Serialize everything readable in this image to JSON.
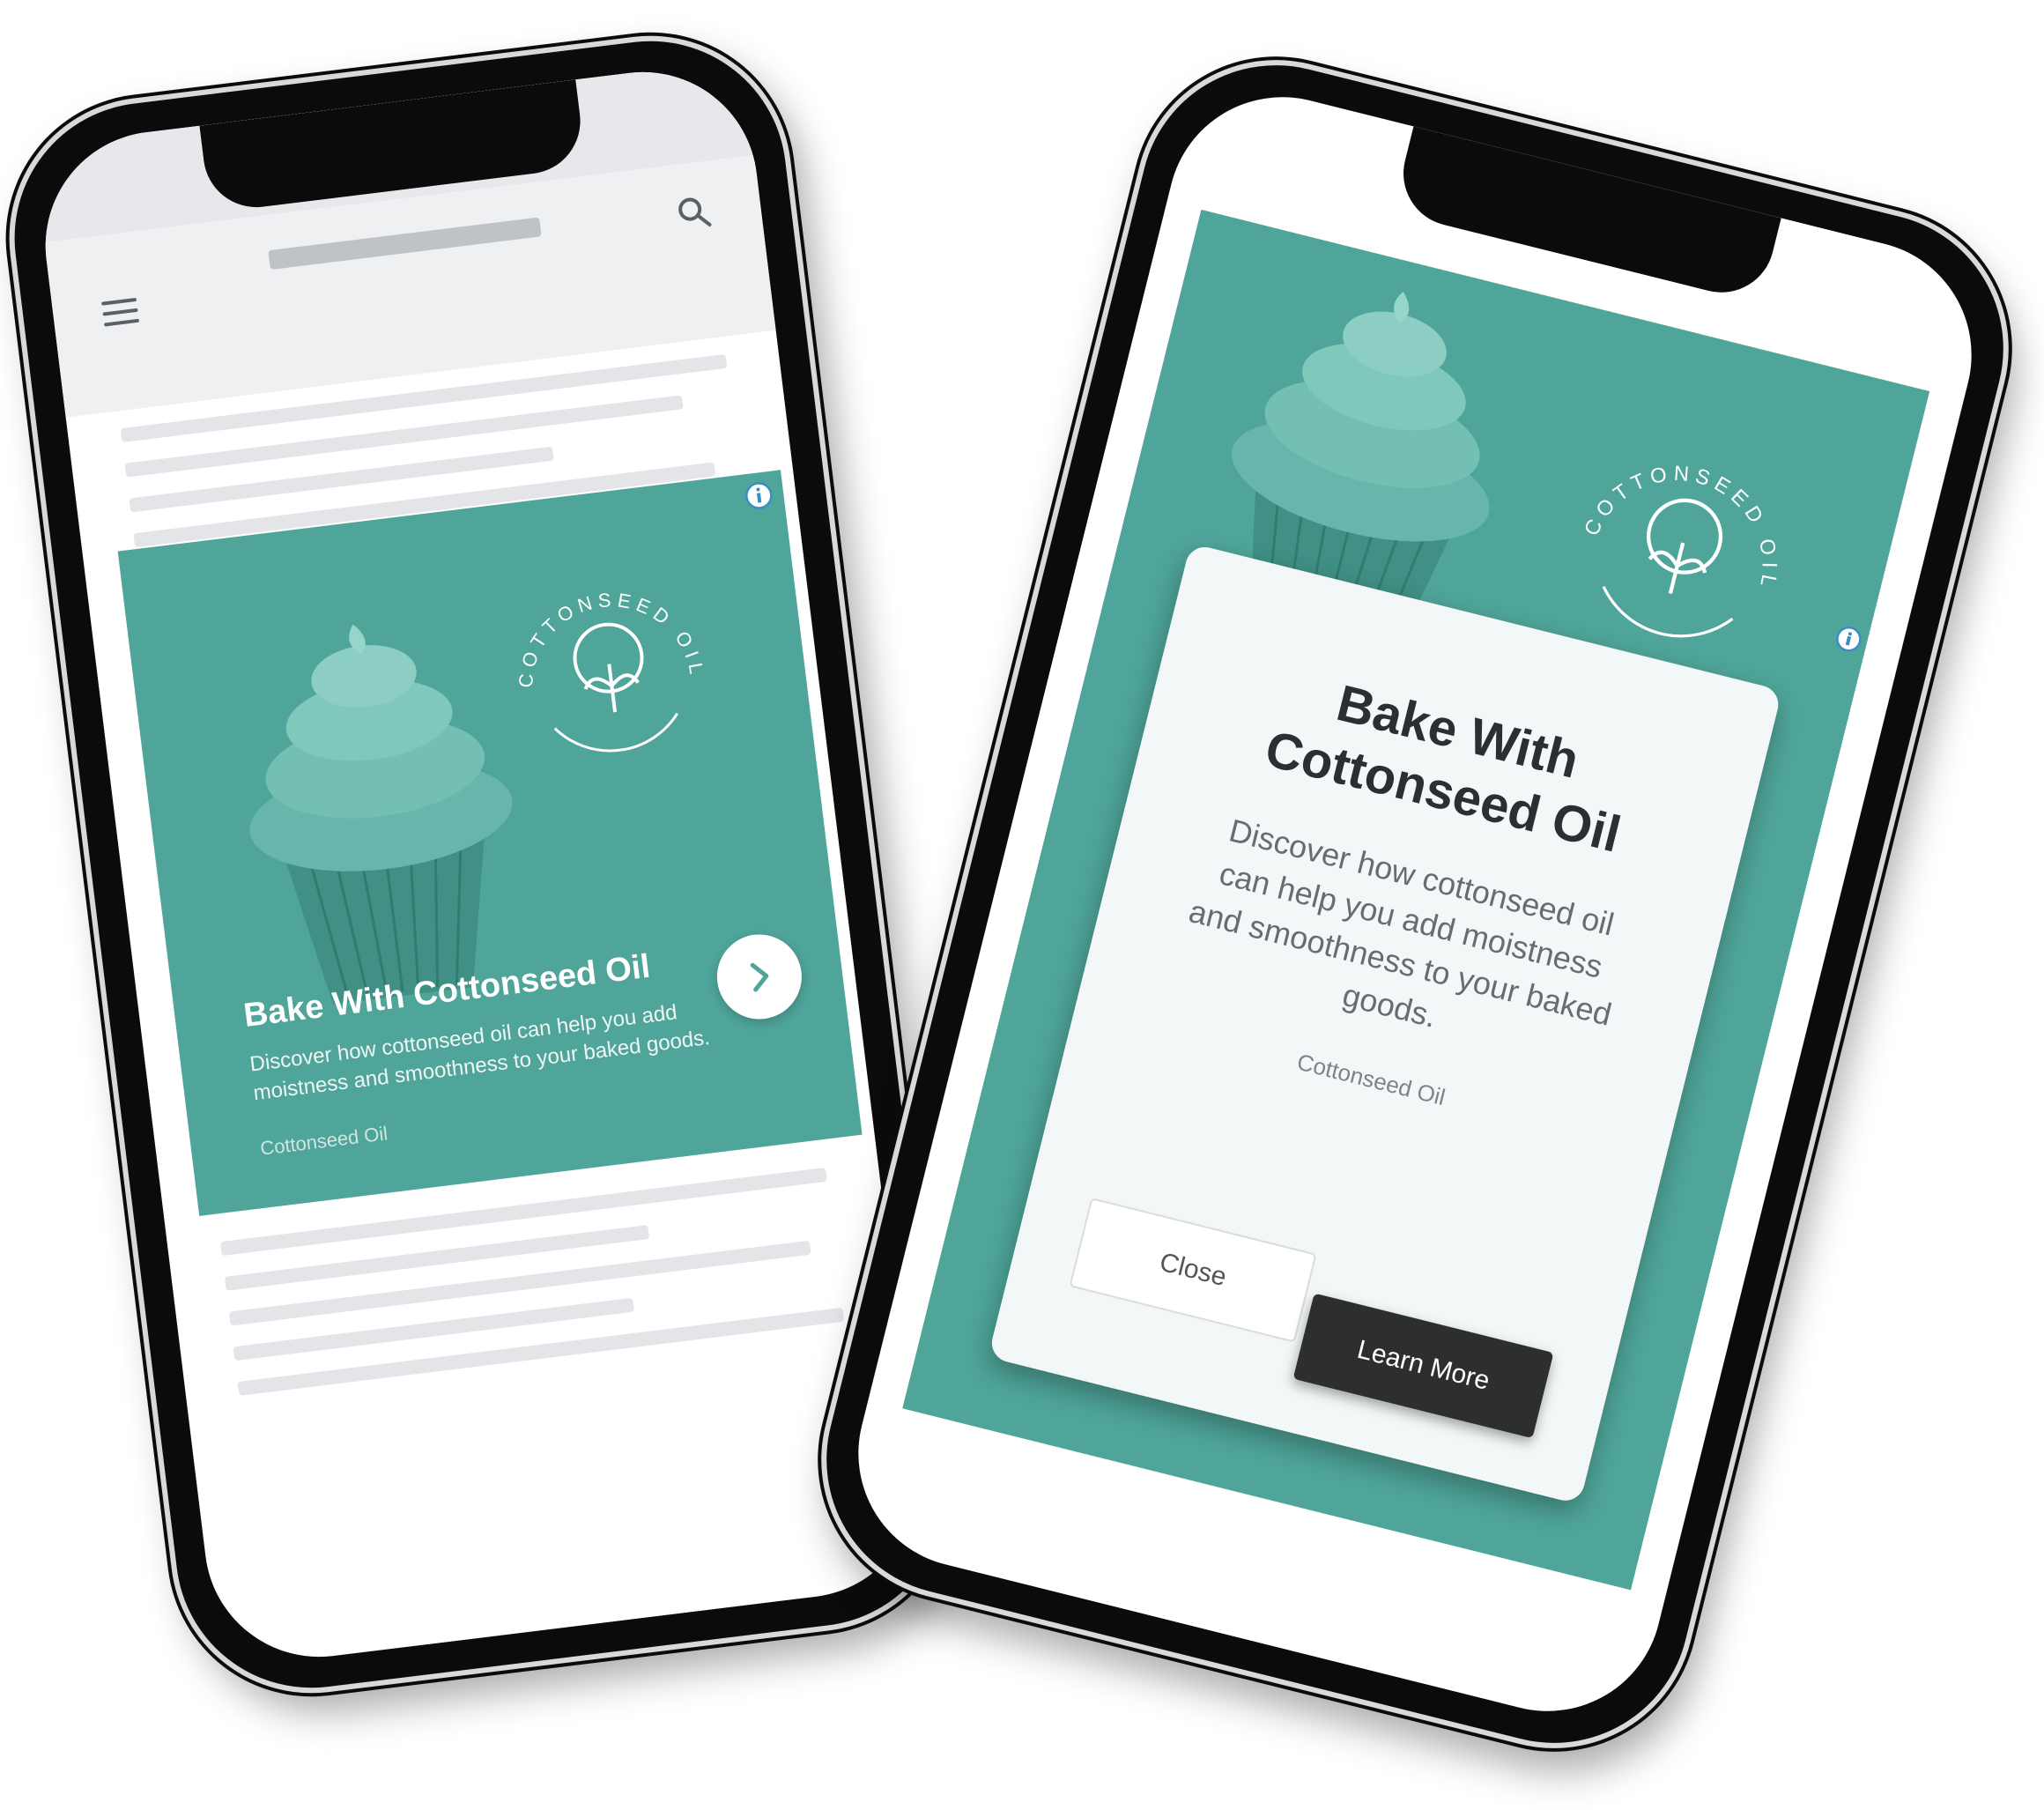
{
  "brand_color": "#4fa59a",
  "phone_left": {
    "icons": {
      "menu": "menu-icon",
      "search": "search-icon",
      "info": "info-icon",
      "arrow": "chevron-right-icon"
    },
    "ad": {
      "logo_text": "COTTONSEED OIL",
      "title": "Bake With Cottonseed Oil",
      "description": "Discover how cottonseed oil can help you add moistness and smoothness to your baked goods.",
      "brand": "Cottonseed Oil"
    }
  },
  "phone_right": {
    "icons": {
      "info": "info-icon"
    },
    "ad": {
      "logo_text": "COTTONSEED OIL",
      "title": "Bake With Cottonseed Oil",
      "description": "Discover how cottonseed oil can help you add moistness and smoothness to your baked goods.",
      "brand": "Cottonseed Oil",
      "close_label": "Close",
      "learn_more_label": "Learn More"
    }
  }
}
